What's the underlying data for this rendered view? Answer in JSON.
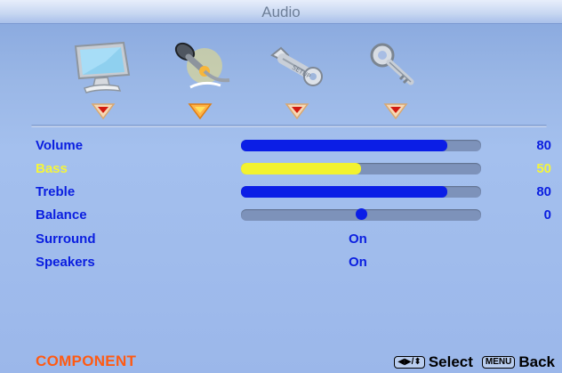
{
  "menu": {
    "title": "Audio",
    "tabs": [
      {
        "icon": "picture-monitor-icon"
      },
      {
        "icon": "audio-microphone-icon"
      },
      {
        "icon": "setup-wrench-icon"
      },
      {
        "icon": "key-lock-icon"
      }
    ],
    "active_tab": 1
  },
  "settings": {
    "volume": {
      "label": "Volume",
      "value": "80",
      "level": 0.86
    },
    "bass": {
      "label": "Bass",
      "value": "50",
      "level": 0.5
    },
    "treble": {
      "label": "Treble",
      "value": "80",
      "level": 0.86
    },
    "balance": {
      "label": "Balance",
      "value": "0",
      "level": 0.5
    },
    "surround": {
      "label": "Surround",
      "value": "On"
    },
    "speakers": {
      "label": "Speakers",
      "value": "On"
    }
  },
  "footer": {
    "source": "COMPONENT",
    "select_key": "◀▶/⬍",
    "select_label": "Select",
    "menu_key": "MENU",
    "back_label": "Back"
  },
  "colors": {
    "label_blue": "#0a1ee0",
    "highlight_yellow": "#f5f53a",
    "source_orange": "#ff5a12"
  }
}
